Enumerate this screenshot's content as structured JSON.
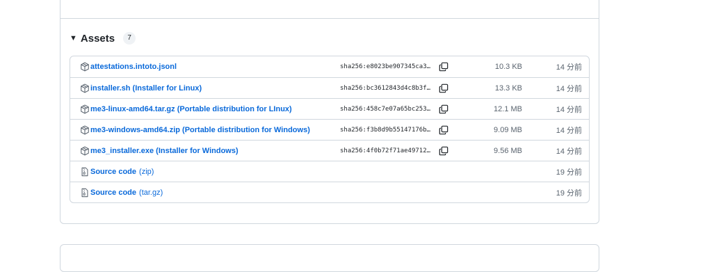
{
  "assets": {
    "title": "Assets",
    "count": "7",
    "rows": [
      {
        "name": "attestations.intoto.jsonl",
        "suffix": "",
        "sha": "sha256:e8023be907345ca3…",
        "size": "10.3 KB",
        "time": "14 分前"
      },
      {
        "name": "installer.sh (Installer for Linux)",
        "suffix": "",
        "sha": "sha256:bc3612843d4c8b3f…",
        "size": "13.3 KB",
        "time": "14 分前"
      },
      {
        "name": "me3-linux-amd64.tar.gz (Portable distribution for LInux)",
        "suffix": "",
        "sha": "sha256:458c7e07a65bc253…",
        "size": "12.1 MB",
        "time": "14 分前"
      },
      {
        "name": "me3-windows-amd64.zip (Portable distribution for Windows)",
        "suffix": "",
        "sha": "sha256:f3b8d9b55147176b…",
        "size": "9.09 MB",
        "time": "14 分前"
      },
      {
        "name": "me3_installer.exe (Installer for Windows)",
        "suffix": "",
        "sha": "sha256:4f0b72f71ae49712…",
        "size": "9.56 MB",
        "time": "14 分前"
      },
      {
        "name": "Source code",
        "suffix": "(zip)",
        "sha": "",
        "size": "",
        "time": "19 分前"
      },
      {
        "name": "Source code",
        "suffix": "(tar.gz)",
        "sha": "",
        "size": "",
        "time": "19 分前"
      }
    ]
  },
  "colors": {
    "link": "#0969da",
    "border": "#d0d7de",
    "muted": "#59636e"
  },
  "icons": {
    "package": "package-icon",
    "zip": "file-zip-icon",
    "copy": "copy-icon",
    "caret": "triangle-down-icon"
  }
}
